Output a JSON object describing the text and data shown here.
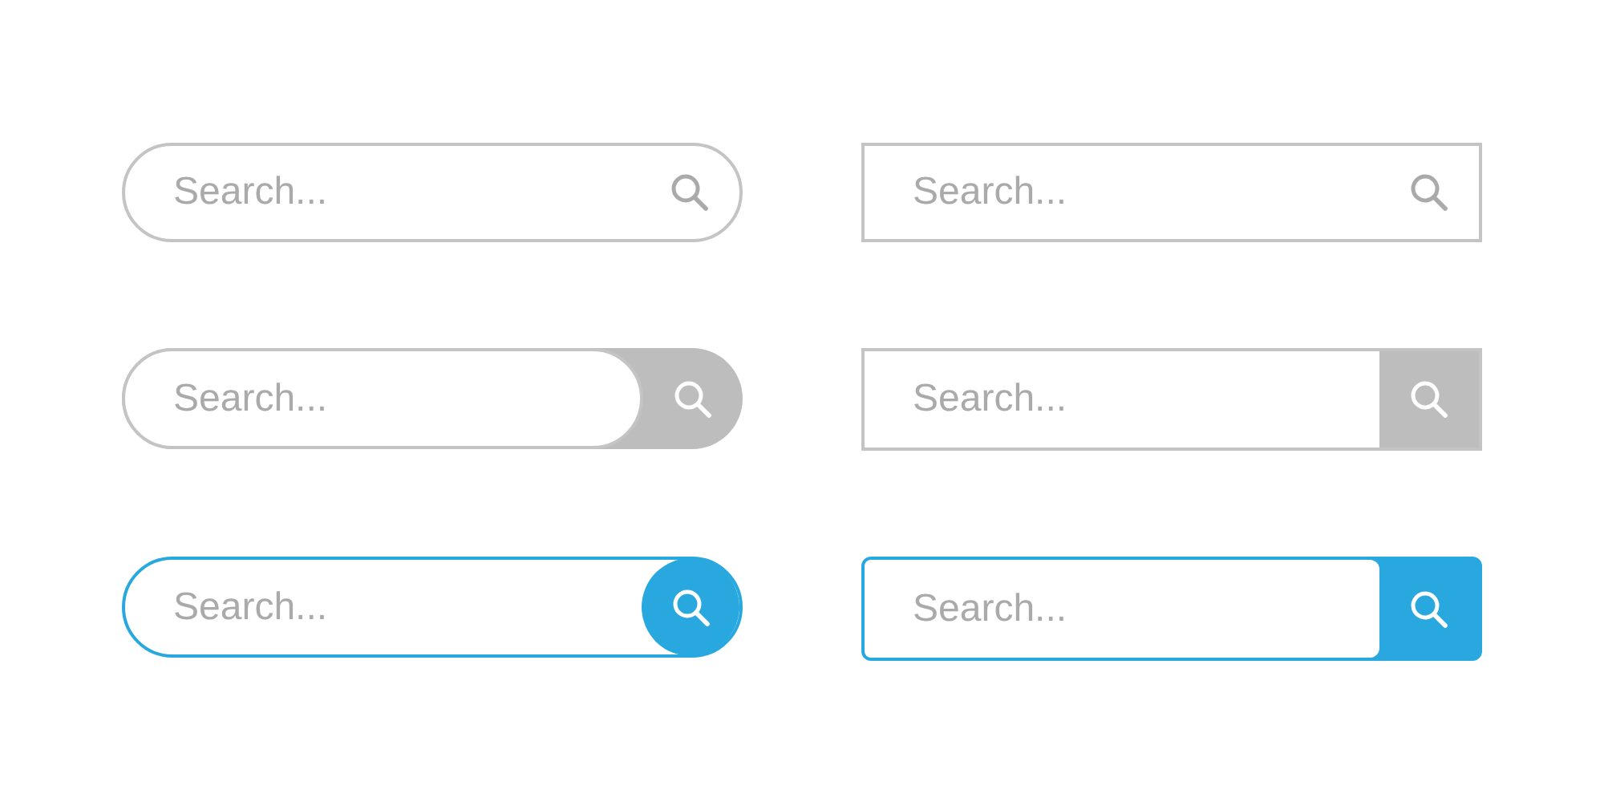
{
  "search_bars": [
    {
      "placeholder": "Search...",
      "rounded": true,
      "kind": "icon"
    },
    {
      "placeholder": "Search...",
      "rounded": false,
      "kind": "icon"
    },
    {
      "placeholder": "Search...",
      "rounded": true,
      "kind": "gray-button"
    },
    {
      "placeholder": "Search...",
      "rounded": false,
      "kind": "gray-button"
    },
    {
      "placeholder": "Search...",
      "rounded": true,
      "kind": "blue-button"
    },
    {
      "placeholder": "Search...",
      "rounded": false,
      "kind": "blue-button"
    }
  ]
}
